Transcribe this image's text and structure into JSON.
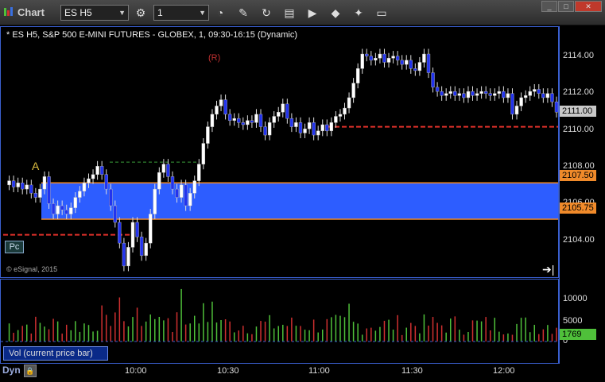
{
  "window": {
    "title": "Chart",
    "symbol": "ES H5",
    "interval": "1",
    "controls": {
      "minimize": "_",
      "maximize": "□",
      "close": "✕"
    }
  },
  "toolbar": [
    {
      "name": "link-icon",
      "glyph": "⚙"
    },
    {
      "name": "clock-icon",
      "glyph": "◔"
    },
    {
      "name": "pencil-icon",
      "glyph": "✎"
    },
    {
      "name": "refresh-icon",
      "glyph": "↻"
    },
    {
      "name": "data-icon",
      "glyph": "▤"
    },
    {
      "name": "play-icon",
      "glyph": "▶"
    },
    {
      "name": "tag-icon",
      "glyph": "◆"
    },
    {
      "name": "comment-icon",
      "glyph": "▭"
    }
  ],
  "chart": {
    "title": "* ES H5, S&P 500 E-MINI FUTURES - GLOBEX, 1, 09:30-16:15 (Dynamic)",
    "watermark": "© eSignal, 2015",
    "pc_button": "Pc",
    "r_marker": "(R)",
    "a_marker": "A",
    "price_ticks": [
      "2114.00",
      "2112.00",
      "2110.00",
      "2108.00",
      "2106.00",
      "2104.00"
    ],
    "price_tags": {
      "last": "2111.00",
      "upper": "2107.50",
      "lower": "2105.75"
    },
    "volume_ticks": [
      "10000",
      "5000",
      "0"
    ],
    "volume_tag": "1769",
    "volume_study": "Vol (current price bar)",
    "time_labels": [
      "10:00",
      "10:30",
      "11:00",
      "11:30",
      "12:00"
    ],
    "dyn_label": "Dyn",
    "colors": {
      "band": "#2d5dff",
      "up": "#ffffff",
      "down": "#2233ee",
      "support": "#e0302a",
      "accent_orange": "#f08a2a",
      "vol_green": "#4fc03a",
      "vol_red": "#d03030"
    }
  },
  "chart_data": {
    "type": "line",
    "price_range": [
      2103.0,
      2115.0
    ],
    "band": [
      2105.75,
      2107.5
    ],
    "levels": [
      2110.2,
      2105.0,
      2108.5
    ],
    "close_series": [
      2107.4,
      2107.6,
      2107.3,
      2107.5,
      2107.2,
      2107.4,
      2107.0,
      2106.8,
      2107.2,
      2107.8,
      2106.5,
      2106.0,
      2106.4,
      2106.2,
      2106.0,
      2106.3,
      2106.8,
      2107.1,
      2107.5,
      2107.7,
      2107.9,
      2108.3,
      2107.9,
      2107.2,
      2106.4,
      2105.6,
      2104.6,
      2103.5,
      2104.4,
      2105.6,
      2104.9,
      2104.0,
      2104.6,
      2106.0,
      2107.2,
      2108.0,
      2108.4,
      2107.8,
      2107.2,
      2106.8,
      2107.4,
      2106.4,
      2107.0,
      2107.6,
      2108.4,
      2109.4,
      2110.2,
      2110.8,
      2111.2,
      2111.5,
      2110.8,
      2110.5,
      2110.6,
      2110.4,
      2110.3,
      2110.5,
      2110.4,
      2110.8,
      2110.2,
      2109.8,
      2110.4,
      2110.7,
      2110.9,
      2111.3,
      2110.6,
      2110.2,
      2110.4,
      2109.9,
      2110.1,
      2110.4,
      2109.8,
      2110.0,
      2110.3,
      2110.0,
      2110.4,
      2110.7,
      2110.8,
      2111.1,
      2111.6,
      2112.3,
      2113.0,
      2113.7,
      2113.6,
      2113.4,
      2113.5,
      2113.7,
      2113.3,
      2113.5,
      2113.6,
      2113.4,
      2113.2,
      2113.4,
      2113.0,
      2112.9,
      2113.3,
      2113.7,
      2112.8,
      2112.1,
      2111.9,
      2111.7,
      2111.8,
      2111.9,
      2111.7,
      2111.8,
      2111.6,
      2111.9,
      2111.7,
      2111.8,
      2111.9,
      2111.8,
      2111.7,
      2111.8,
      2111.9,
      2111.6,
      2111.8,
      2110.8,
      2111.2,
      2111.6,
      2111.7,
      2111.9,
      2112.0,
      2111.8,
      2111.6,
      2111.8,
      2111.4,
      2110.9
    ]
  }
}
